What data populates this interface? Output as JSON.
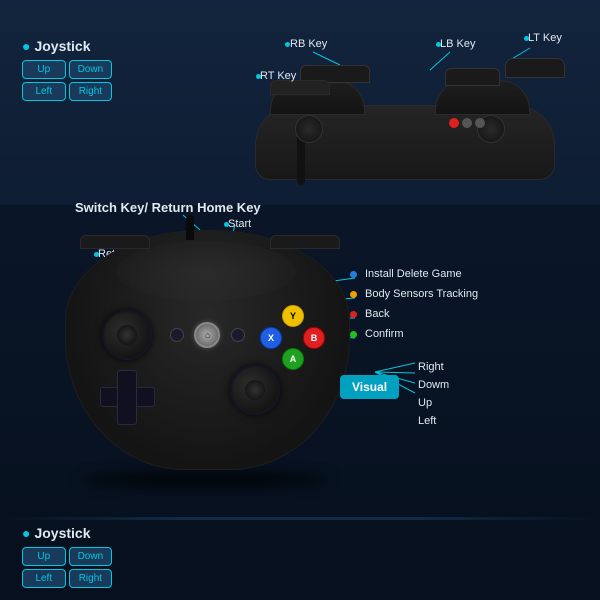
{
  "top_section": {
    "joystick_label": "Joystick",
    "keys": {
      "up": "Up",
      "down": "Down",
      "left": "Left",
      "right": "Right"
    },
    "annotations": {
      "rb_key": "RB Key",
      "lb_key": "LB Key",
      "lt_key": "LT Key",
      "rt_key": "RT Key"
    }
  },
  "middle_section": {
    "switch_key_label": "Switch Key/ Return Home Key",
    "return_label": "Return",
    "start_label": "Start"
  },
  "bottom_section": {
    "joystick_label": "Joystick",
    "keys": {
      "up": "Up",
      "down": "Down",
      "left": "Left",
      "right": "Right"
    },
    "visual_label": "Visual",
    "direction_labels": {
      "right": "Right",
      "down": "Dowm",
      "up": "Up",
      "left": "Left"
    },
    "button_labels": {
      "y": "Y",
      "b": "B",
      "a": "A",
      "x": "X"
    },
    "annotations": {
      "install_delete": "Install Delete Game",
      "body_sensors": "Body Sensors Tracking",
      "back": "Back",
      "confirm": "Confirm"
    }
  }
}
